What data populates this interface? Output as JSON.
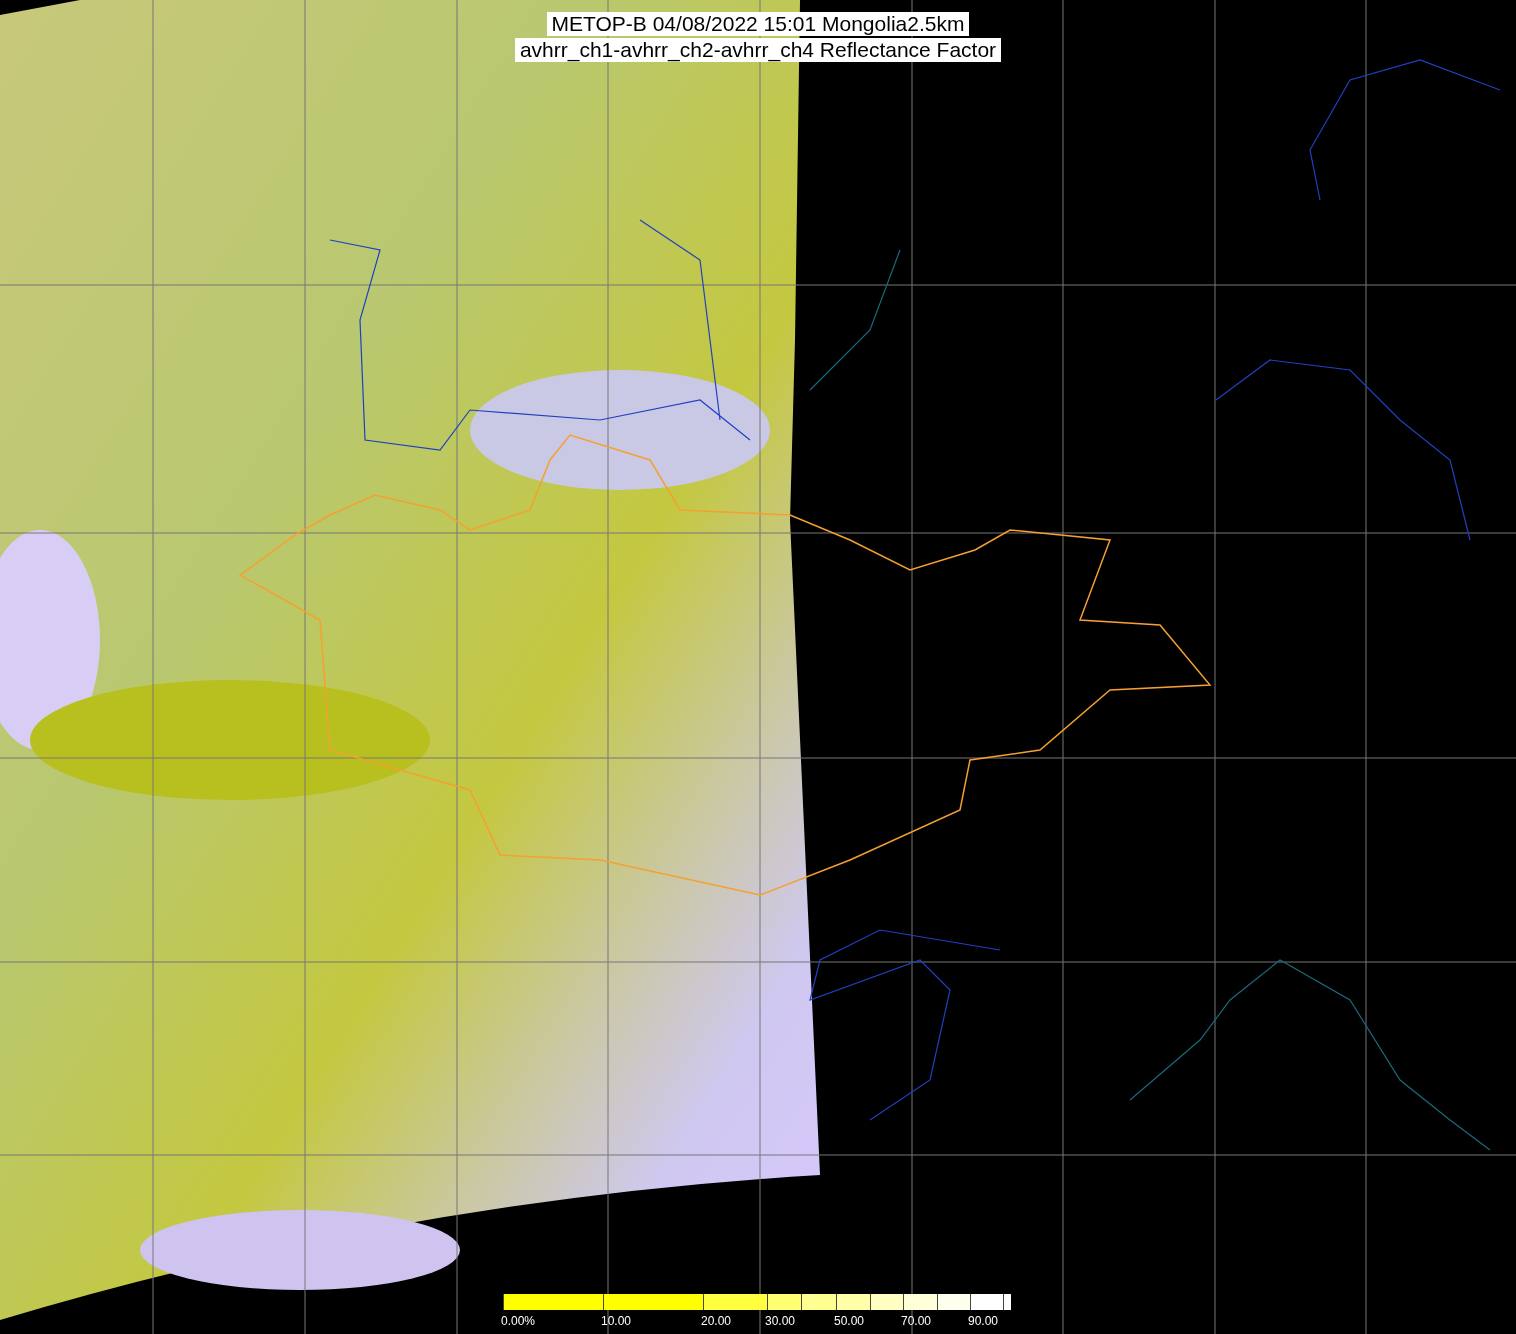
{
  "title": {
    "lines": [
      "METOP-B 04/08/2022 15:01 Mongolia2.5km",
      "avhrr_ch1-avhrr_ch2-avhrr_ch4 Reflectance Factor"
    ]
  },
  "colorbar": {
    "segments": [
      {
        "color": "#ffff00",
        "label": "0.00%"
      },
      {
        "color": "#ffff00",
        "label": "10.00"
      },
      {
        "color": "#ffff40",
        "label": "20.00"
      },
      {
        "color": "#ffff70",
        "label": "30.00"
      },
      {
        "color": "#ffff90"
      },
      {
        "color": "#ffffa8",
        "label": "50.00"
      },
      {
        "color": "#ffffc0"
      },
      {
        "color": "#ffffd8",
        "label": "70.00"
      },
      {
        "color": "#ffffee"
      },
      {
        "color": "#ffffff",
        "label": "90.00"
      },
      {
        "color": "#ffffff"
      }
    ]
  }
}
